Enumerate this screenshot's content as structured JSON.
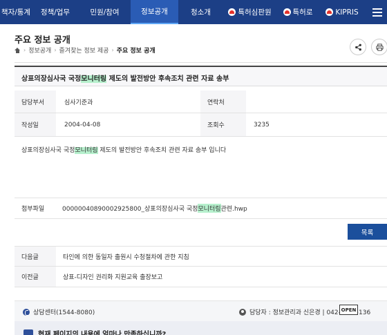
{
  "nav": {
    "tabs": [
      "책자/통계",
      "정책/업무",
      "민원/참여",
      "정보공개",
      "청소개"
    ],
    "ext_links": [
      "특허심판원",
      "특허로",
      "KIPRIS"
    ],
    "active_tab": "정보공개"
  },
  "page": {
    "title": "주요 정보 공개",
    "breadcrumb": [
      "정보공개",
      "즐겨찾는 정보 제공",
      "주요 정보 공개"
    ]
  },
  "article": {
    "title_pre": "상표의장심사국 국정",
    "title_hl": "모니터링",
    "title_post": " 제도의 발전방안 후속조치 관련 자료 송부",
    "dept_label": "담당부서",
    "dept_value": "심사기준과",
    "contact_label": "연락처",
    "contact_value": "",
    "date_label": "작성일",
    "date_value": "2004-04-08",
    "views_label": "조회수",
    "views_value": "3235",
    "content_pre": "상표의장심사국 국정",
    "content_hl": "모니터링",
    "content_post": " 제도의 발전방안 후속조치 관련 자료 송부 입니다",
    "file_label": "첨부파일",
    "file_pre": "00000040890002925800_상표의장심사국 국정",
    "file_hl": "모니터링",
    "file_post": " 관련.hwp"
  },
  "buttons": {
    "list": "목록"
  },
  "nav_posts": {
    "next_label": "다음글",
    "next_title": "타인에 의한 동일자 출원시 수청절차에 관한 지침",
    "prev_label": "이전글",
    "prev_title": "상표-디자인 권리화 지원교육 출장보고"
  },
  "footer": {
    "call_center": "상담센터(1544-8080)",
    "manager": "담당자 : 정보관리과 신은경 | 042-481-5136",
    "open_badge": "OPEN",
    "survey_text": "현재 페이지의 내용에 얼마나 만족하십니까?"
  },
  "colors": {
    "nav_bg": "#1c3f86",
    "nav_active": "#2a5cb5",
    "button_bg": "#1b4f9c",
    "highlight": "#b6f0cd"
  },
  "icons": [
    "home-icon",
    "share-icon",
    "print-icon",
    "phone-icon",
    "person-icon",
    "menu-icon",
    "survey-icon"
  ]
}
